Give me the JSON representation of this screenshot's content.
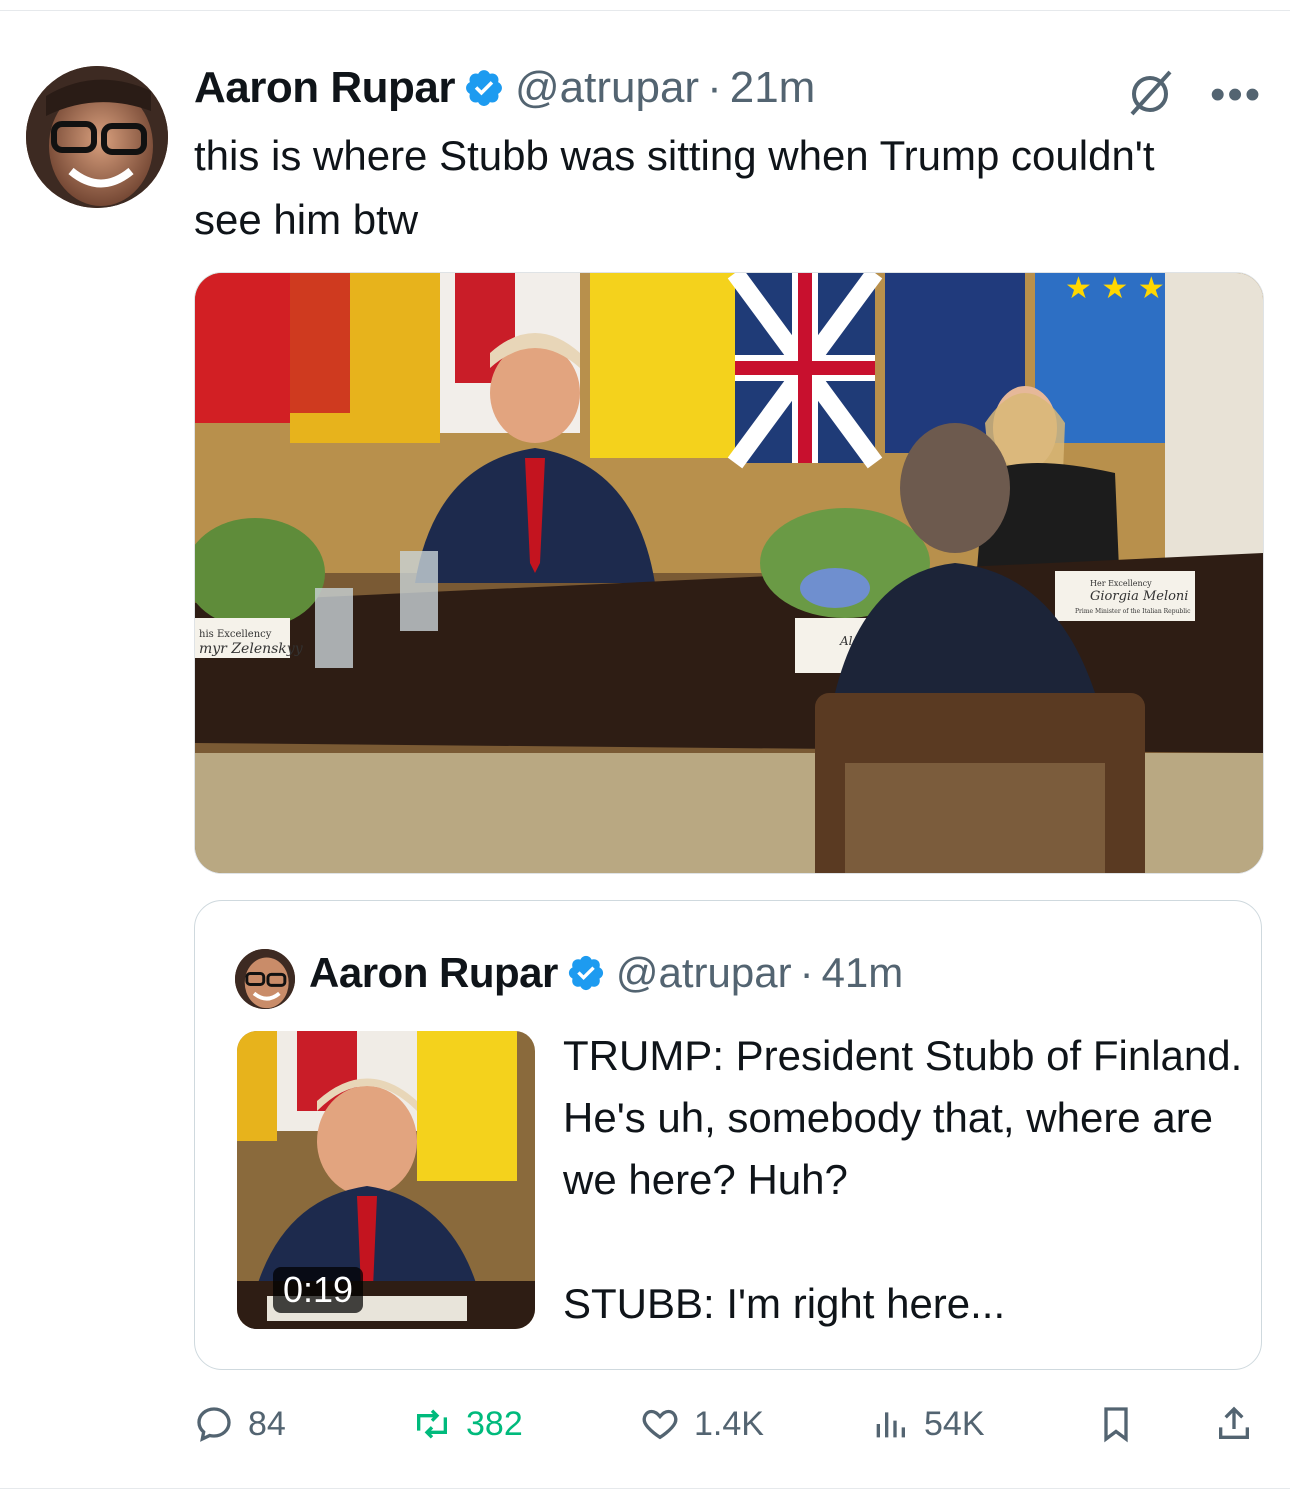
{
  "tweet": {
    "author_name": "Aaron Rupar",
    "handle": "@atrupar",
    "separator": "·",
    "time": "21m",
    "text": "this is where Stubb was sitting when Trump couldn't see him btw",
    "more_icon": "more-icon",
    "grok_icon": "grok-icon"
  },
  "media": {
    "signs": [
      "his Excellency",
      "myr Zelenskyy",
      "Her Excellency",
      "Giorgia Meloni",
      "Prime Minister of the Italian Republic",
      "Alex"
    ]
  },
  "quoted_tweet": {
    "author_name": "Aaron Rupar",
    "handle": "@atrupar",
    "separator": "·",
    "time": "41m",
    "video_duration": "0:19",
    "text": "TRUMP: President Stubb of Finland. He's uh, somebody that, where are we here? Huh?\n\nSTUBB: I'm right here..."
  },
  "actions": {
    "replies": "84",
    "reposts": "382",
    "likes": "1.4K",
    "views": "54K"
  },
  "colors": {
    "text": "#0f1419",
    "secondary": "#536471",
    "verified": "#1d9bf0",
    "repost": "#00ba7c"
  }
}
